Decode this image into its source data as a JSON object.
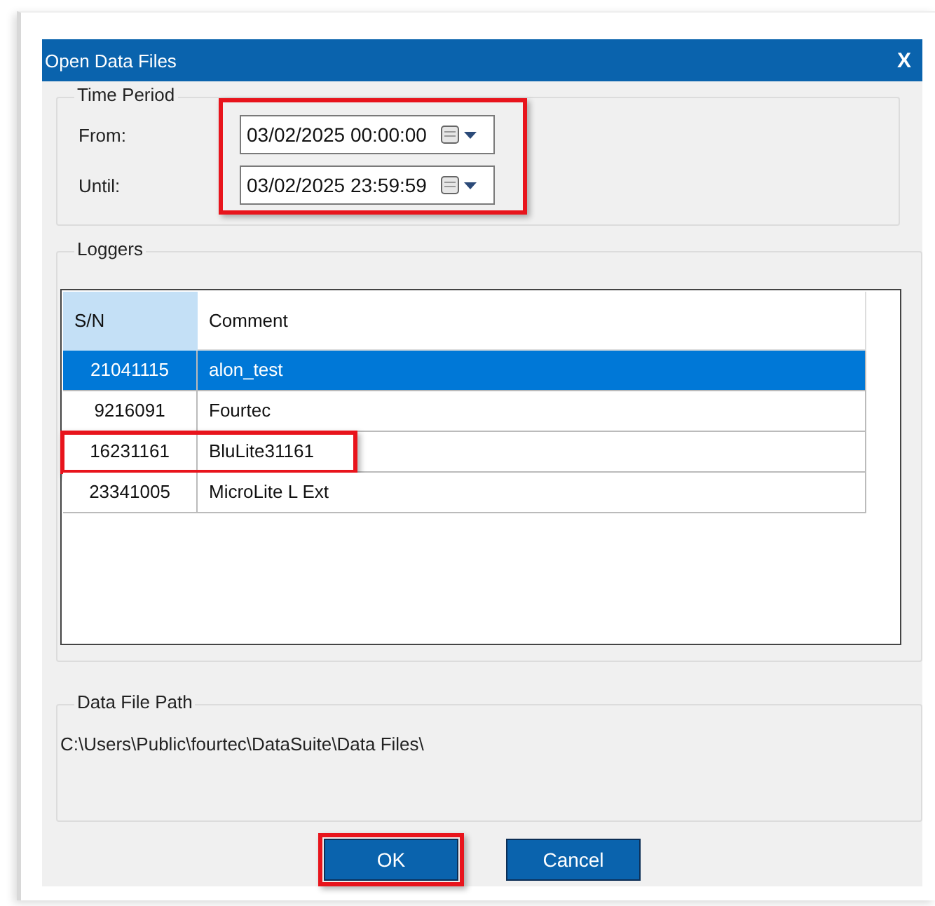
{
  "window": {
    "title": "Open Data Files",
    "close_label": "X"
  },
  "time_period": {
    "title": "Time Period",
    "highlighted": true,
    "fields": [
      {
        "label": "From:",
        "value": "03/02/2025 00:00:00"
      },
      {
        "label": "Until:",
        "value": "03/02/2025 23:59:59"
      }
    ]
  },
  "loggers": {
    "title": "Loggers",
    "columns": [
      {
        "label": "S/N",
        "selected": true
      },
      {
        "label": "Comment",
        "selected": false
      }
    ],
    "rows": [
      {
        "sn": "21041115",
        "comment": "alon_test",
        "selected": true,
        "highlighted": false
      },
      {
        "sn": "9216091",
        "comment": "Fourtec",
        "selected": false,
        "highlighted": false
      },
      {
        "sn": "16231161",
        "comment": "BluLite31161",
        "selected": false,
        "highlighted": true
      },
      {
        "sn": "23341005",
        "comment": "MicroLite L Ext",
        "selected": false,
        "highlighted": false
      }
    ]
  },
  "data_file_path": {
    "title": "Data File Path",
    "path": "C:\\Users\\Public\\fourtec\\DataSuite\\Data Files\\"
  },
  "buttons": [
    {
      "label": "OK",
      "highlighted": true
    },
    {
      "label": "Cancel",
      "highlighted": false
    }
  ]
}
